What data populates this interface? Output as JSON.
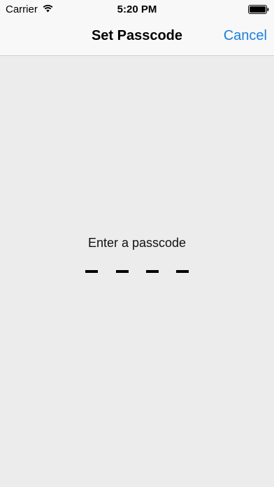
{
  "status_bar": {
    "carrier": "Carrier",
    "time": "5:20 PM",
    "wifi_icon": "wifi-icon",
    "battery_icon": "battery-icon"
  },
  "nav": {
    "title": "Set Passcode",
    "cancel_label": "Cancel",
    "accent_color": "#1a7fe0"
  },
  "passcode": {
    "prompt": "Enter a passcode",
    "digit_count": 4,
    "entered_count": 0
  },
  "colors": {
    "background": "#ececec",
    "bar_background": "#f8f8f8"
  }
}
